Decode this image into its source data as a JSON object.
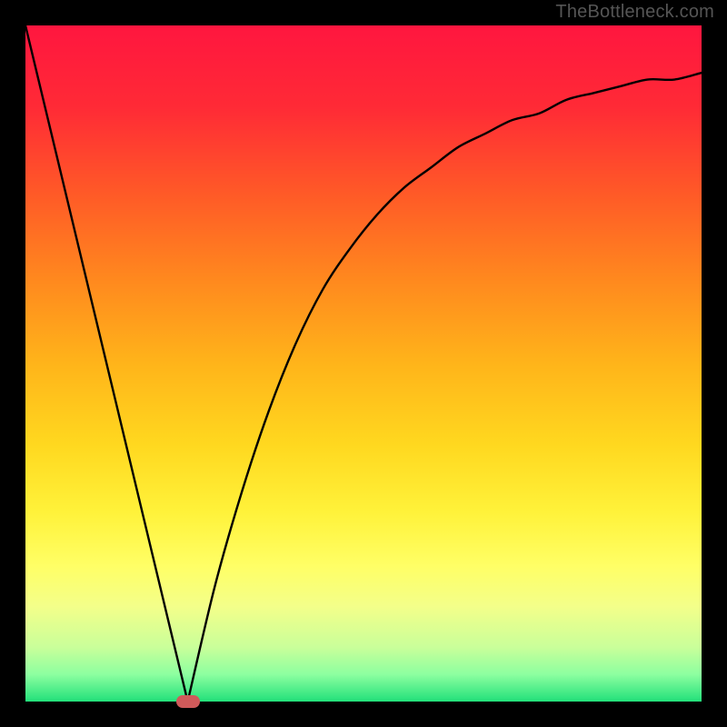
{
  "watermark": "TheBottleneck.com",
  "chart_data": {
    "type": "line",
    "title": "",
    "xlabel": "",
    "ylabel": "",
    "xlim": [
      0,
      1
    ],
    "ylim": [
      0,
      1
    ],
    "grid": false,
    "series": [
      {
        "name": "left-branch",
        "x": [
          0.0,
          0.24
        ],
        "y": [
          1.0,
          0.0
        ]
      },
      {
        "name": "right-branch",
        "x": [
          0.24,
          0.28,
          0.32,
          0.36,
          0.4,
          0.44,
          0.48,
          0.52,
          0.56,
          0.6,
          0.64,
          0.68,
          0.72,
          0.76,
          0.8,
          0.84,
          0.88,
          0.92,
          0.96,
          1.0
        ],
        "y": [
          0.0,
          0.17,
          0.31,
          0.43,
          0.53,
          0.61,
          0.67,
          0.72,
          0.76,
          0.79,
          0.82,
          0.84,
          0.86,
          0.87,
          0.89,
          0.9,
          0.91,
          0.92,
          0.92,
          0.93
        ]
      }
    ],
    "gradient_stops": [
      {
        "offset": 0.0,
        "color": "#ff163f"
      },
      {
        "offset": 0.12,
        "color": "#ff2a36"
      },
      {
        "offset": 0.25,
        "color": "#ff5a27"
      },
      {
        "offset": 0.38,
        "color": "#ff8a1e"
      },
      {
        "offset": 0.5,
        "color": "#ffb41a"
      },
      {
        "offset": 0.62,
        "color": "#ffd81f"
      },
      {
        "offset": 0.72,
        "color": "#fff23a"
      },
      {
        "offset": 0.8,
        "color": "#ffff66"
      },
      {
        "offset": 0.86,
        "color": "#f3ff8a"
      },
      {
        "offset": 0.92,
        "color": "#c9ff9a"
      },
      {
        "offset": 0.96,
        "color": "#8cffa0"
      },
      {
        "offset": 1.0,
        "color": "#22e07a"
      }
    ],
    "optimum_marker": {
      "x": 0.24,
      "y": 0.0,
      "color": "#cf5a5a"
    }
  }
}
